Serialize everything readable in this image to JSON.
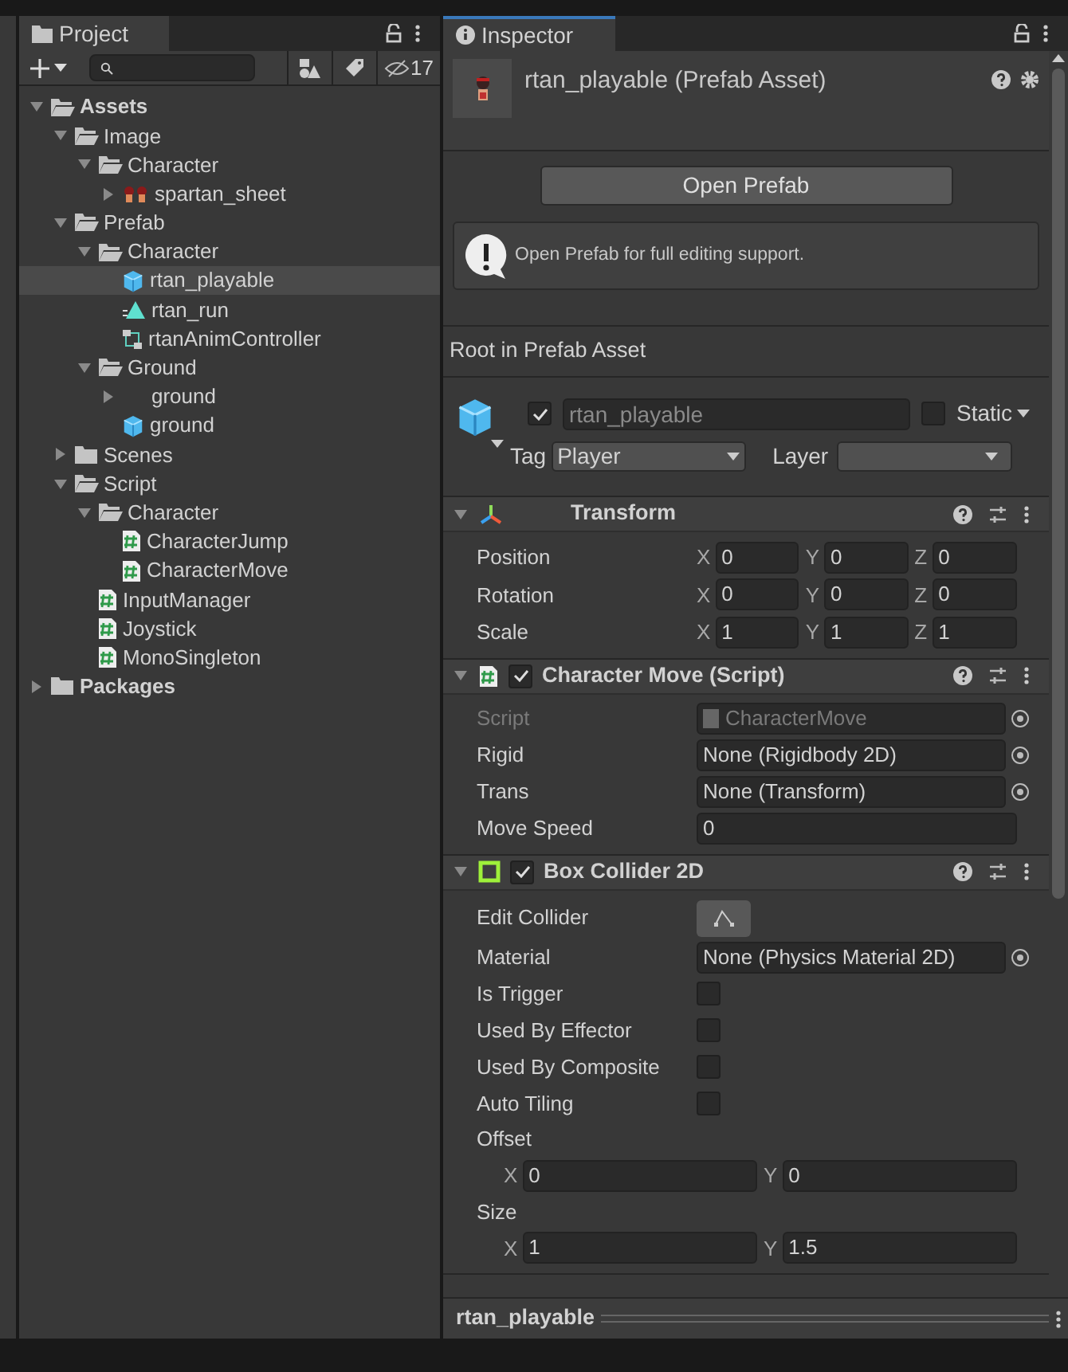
{
  "project": {
    "tab": {
      "title": "Project",
      "selected": true
    },
    "hidden_count": "17",
    "tree": [
      {
        "label": "Assets",
        "kind": "folder",
        "bold": true,
        "expanded": true,
        "selected": false,
        "children": [
          {
            "label": "Image",
            "kind": "folder",
            "expanded": true,
            "selected": false,
            "children": [
              {
                "label": "Character",
                "kind": "folder",
                "expanded": true,
                "selected": false,
                "children": [
                  {
                    "label": "spartan_sheet",
                    "kind": "sprite",
                    "expanded": false,
                    "selected": false
                  }
                ]
              }
            ]
          },
          {
            "label": "Prefab",
            "kind": "folder",
            "expanded": true,
            "selected": false,
            "children": [
              {
                "label": "Character",
                "kind": "folder",
                "expanded": true,
                "selected": false,
                "children": [
                  {
                    "label": "rtan_playable",
                    "kind": "prefab",
                    "selected": true
                  },
                  {
                    "label": "rtan_run",
                    "kind": "anim",
                    "selected": false
                  },
                  {
                    "label": "rtanAnimController",
                    "kind": "controller",
                    "selected": false
                  }
                ]
              },
              {
                "label": "Ground",
                "kind": "folder",
                "expanded": true,
                "selected": false,
                "children": [
                  {
                    "label": "ground",
                    "kind": "blank",
                    "expanded": false,
                    "selected": false
                  },
                  {
                    "label": "ground",
                    "kind": "prefab",
                    "selected": false
                  }
                ]
              }
            ]
          },
          {
            "label": "Scenes",
            "kind": "folder",
            "expanded": false,
            "selected": false
          },
          {
            "label": "Script",
            "kind": "folder",
            "expanded": true,
            "selected": false,
            "children": [
              {
                "label": "Character",
                "kind": "folder",
                "expanded": true,
                "selected": false,
                "children": [
                  {
                    "label": "CharacterJump",
                    "kind": "script",
                    "selected": false
                  },
                  {
                    "label": "CharacterMove",
                    "kind": "script",
                    "selected": false
                  }
                ]
              },
              {
                "label": "InputManager",
                "kind": "script",
                "selected": false
              },
              {
                "label": "Joystick",
                "kind": "script",
                "selected": false
              },
              {
                "label": "MonoSingleton",
                "kind": "script",
                "selected": false
              }
            ]
          }
        ]
      },
      {
        "label": "Packages",
        "kind": "folder",
        "bold": true,
        "expanded": false,
        "selected": false
      }
    ]
  },
  "inspector": {
    "tab": {
      "title": "Inspector",
      "selected": true
    },
    "header": {
      "title": "rtan_playable (Prefab Asset)"
    },
    "open_button": "Open Prefab",
    "help_text": "Open Prefab for full editing support.",
    "section_title": "Root in Prefab Asset",
    "game_object": {
      "active": true,
      "name": "rtan_playable",
      "static": false,
      "static_label": "Static",
      "tag_label": "Tag",
      "tag": "Player",
      "layer_label": "Layer"
    },
    "components": [
      {
        "title": "Transform",
        "kind": "transform",
        "expanded": true,
        "rows": [
          {
            "kind": "vector3",
            "label": "Position",
            "values": [
              {
                "axis": "X",
                "value": "0"
              },
              {
                "axis": "Y",
                "value": "0"
              },
              {
                "axis": "Z",
                "value": "0"
              }
            ]
          },
          {
            "kind": "vector3",
            "label": "Rotation",
            "values": [
              {
                "axis": "X",
                "value": "0"
              },
              {
                "axis": "Y",
                "value": "0"
              },
              {
                "axis": "Z",
                "value": "0"
              }
            ]
          },
          {
            "kind": "vector3",
            "label": "Scale",
            "values": [
              {
                "axis": "X",
                "value": "1"
              },
              {
                "axis": "Y",
                "value": "1"
              },
              {
                "axis": "Z",
                "value": "1"
              }
            ]
          }
        ]
      },
      {
        "title": "Character Move (Script)",
        "kind": "script",
        "enabled": true,
        "expanded": true,
        "rows": [
          {
            "kind": "object",
            "label": "Script",
            "value": "CharacterMove",
            "disabled": true
          },
          {
            "kind": "object",
            "label": "Rigid",
            "value": "None (Rigidbody 2D)",
            "disabled": false
          },
          {
            "kind": "object",
            "label": "Trans",
            "value": "None (Transform)",
            "disabled": false
          },
          {
            "kind": "text",
            "label": "Move Speed",
            "value": "0"
          }
        ]
      },
      {
        "title": "Box Collider 2D",
        "kind": "collider",
        "enabled": true,
        "expanded": true,
        "rows": [
          {
            "kind": "button",
            "label": "Edit Collider"
          },
          {
            "kind": "object",
            "label": "Material",
            "value": "None (Physics Material 2D)",
            "disabled": false
          },
          {
            "kind": "checkbox",
            "label": "Is Trigger",
            "checked": false
          },
          {
            "kind": "checkbox",
            "label": "Used By Effector",
            "checked": false
          },
          {
            "kind": "checkbox",
            "label": "Used By Composite",
            "checked": false
          },
          {
            "kind": "checkbox",
            "label": "Auto Tiling",
            "checked": false
          },
          {
            "kind": "vector2",
            "label": "Offset",
            "values": [
              {
                "axis": "X",
                "value": "0"
              },
              {
                "axis": "Y",
                "value": "0"
              }
            ]
          },
          {
            "kind": "vector2",
            "label": "Size",
            "values": [
              {
                "axis": "X",
                "value": "1"
              },
              {
                "axis": "Y",
                "value": "1.5"
              }
            ]
          }
        ]
      }
    ],
    "footer": "rtan_playable"
  }
}
